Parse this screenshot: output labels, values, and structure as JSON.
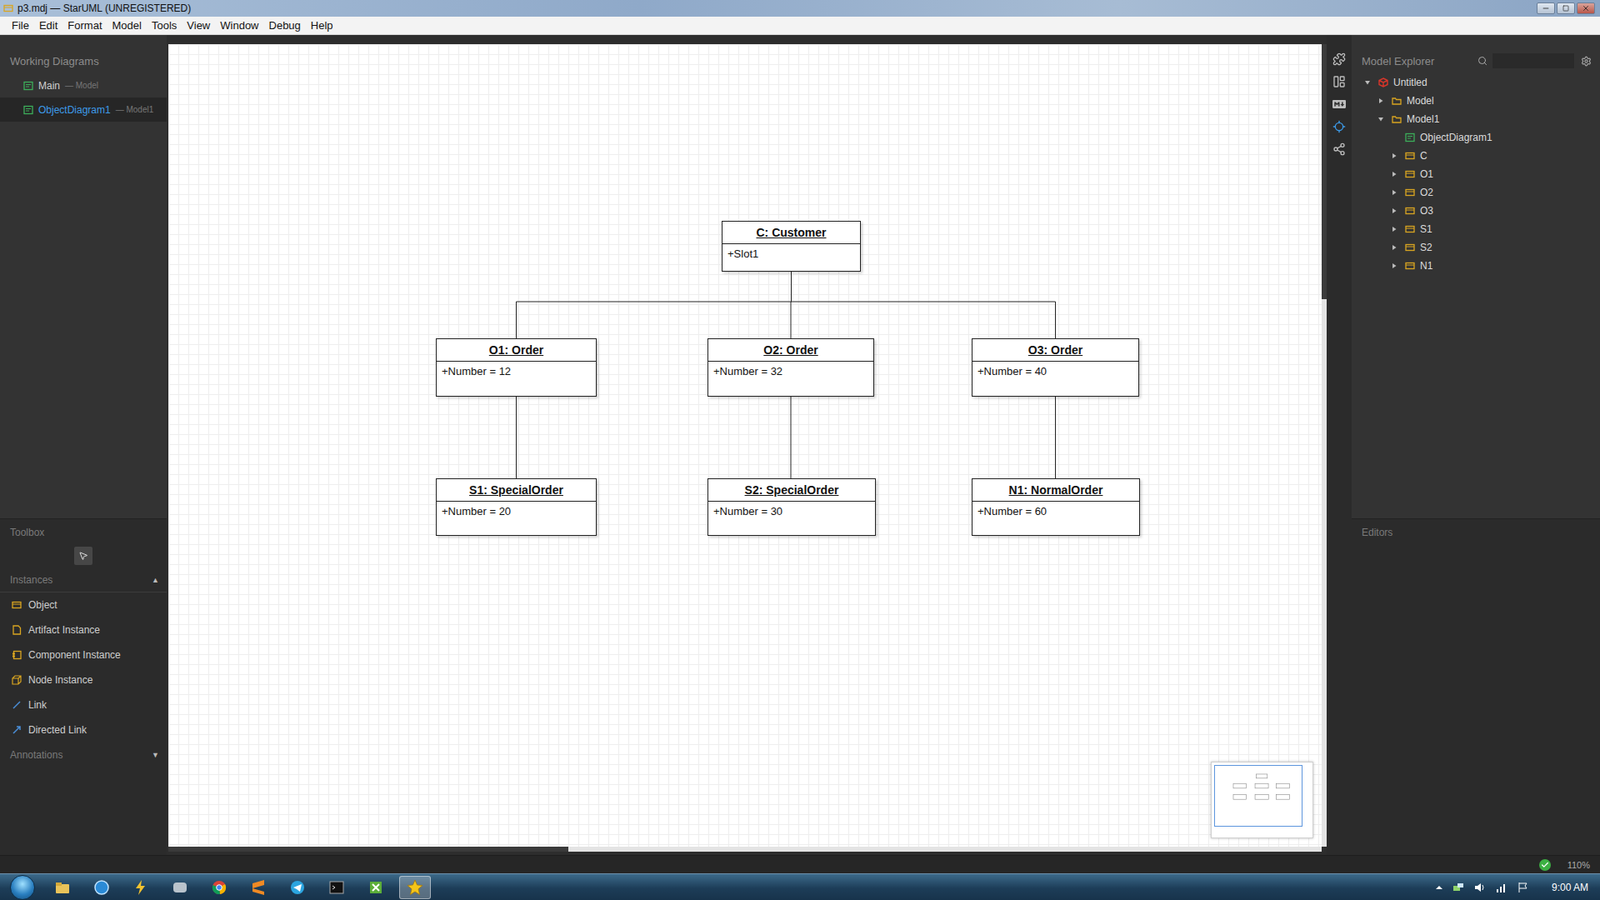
{
  "window": {
    "title": "p3.mdj — StarUML (UNREGISTERED)"
  },
  "menu": [
    "File",
    "Edit",
    "Format",
    "Model",
    "Tools",
    "View",
    "Window",
    "Debug",
    "Help"
  ],
  "working_diagrams": {
    "title": "Working Diagrams",
    "items": [
      {
        "label": "Main",
        "owner": "— Model",
        "selected": false
      },
      {
        "label": "ObjectDiagram1",
        "owner": "— Model1",
        "selected": true
      }
    ]
  },
  "toolbox": {
    "title": "Toolbox",
    "sections": [
      {
        "title": "Instances",
        "toggle": "▲",
        "expanded": true,
        "items": [
          {
            "label": "Object",
            "kind": "object"
          },
          {
            "label": "Artifact Instance",
            "kind": "artifact"
          },
          {
            "label": "Component Instance",
            "kind": "component"
          },
          {
            "label": "Node Instance",
            "kind": "node"
          },
          {
            "label": "Link",
            "kind": "link"
          },
          {
            "label": "Directed Link",
            "kind": "directed-link"
          }
        ]
      },
      {
        "title": "Annotations",
        "toggle": "▼",
        "expanded": false,
        "items": []
      }
    ]
  },
  "diagram": {
    "objects": [
      {
        "title": "C: Customer",
        "slot": "+Slot1"
      },
      {
        "title": "O1: Order",
        "slot": "+Number = 12"
      },
      {
        "title": "O2: Order",
        "slot": "+Number = 32"
      },
      {
        "title": "O3: Order",
        "slot": "+Number = 40"
      },
      {
        "title": "S1: SpecialOrder",
        "slot": "+Number = 20"
      },
      {
        "title": "S2: SpecialOrder",
        "slot": "+Number = 30"
      },
      {
        "title": "N1: NormalOrder",
        "slot": "+Number = 60"
      }
    ]
  },
  "side_tools": [
    {
      "kind": "extensions",
      "selected": false
    },
    {
      "kind": "layout",
      "selected": false
    },
    {
      "kind": "markdown",
      "selected": false
    },
    {
      "kind": "navigator",
      "selected": true
    },
    {
      "kind": "share",
      "selected": false
    }
  ],
  "model_explorer": {
    "title": "Model Explorer",
    "tree": [
      {
        "label": "Untitled",
        "kind": "project",
        "expanded": true,
        "children": [
          {
            "label": "Model",
            "kind": "model",
            "expanded": false,
            "children": []
          },
          {
            "label": "Model1",
            "kind": "model",
            "expanded": true,
            "children": [
              {
                "label": "ObjectDiagram1",
                "kind": "diagram",
                "children": []
              },
              {
                "label": "C",
                "kind": "object",
                "expanded": false,
                "children": []
              },
              {
                "label": "O1",
                "kind": "object",
                "expanded": false,
                "children": []
              },
              {
                "label": "O2",
                "kind": "object",
                "expanded": false,
                "children": []
              },
              {
                "label": "O3",
                "kind": "object",
                "expanded": false,
                "children": []
              },
              {
                "label": "S1",
                "kind": "object",
                "expanded": false,
                "children": []
              },
              {
                "label": "S2",
                "kind": "object",
                "expanded": false,
                "children": []
              },
              {
                "label": "N1",
                "kind": "object",
                "expanded": false,
                "children": []
              }
            ]
          }
        ]
      }
    ]
  },
  "editors": {
    "title": "Editors"
  },
  "status_bar": {
    "valid": true,
    "zoom": "110%"
  },
  "taskbar": {
    "clock": "9:00 AM",
    "apps": [
      {
        "kind": "explorer",
        "selected": false
      },
      {
        "kind": "browser",
        "selected": false
      },
      {
        "kind": "tool",
        "selected": false
      },
      {
        "kind": "game",
        "selected": false
      },
      {
        "kind": "chrome",
        "selected": false
      },
      {
        "kind": "sublime",
        "selected": false
      },
      {
        "kind": "telegram",
        "selected": false
      },
      {
        "kind": "cmd",
        "selected": false
      },
      {
        "kind": "spreadsheet",
        "selected": false
      },
      {
        "kind": "staruml",
        "selected": true
      }
    ]
  }
}
